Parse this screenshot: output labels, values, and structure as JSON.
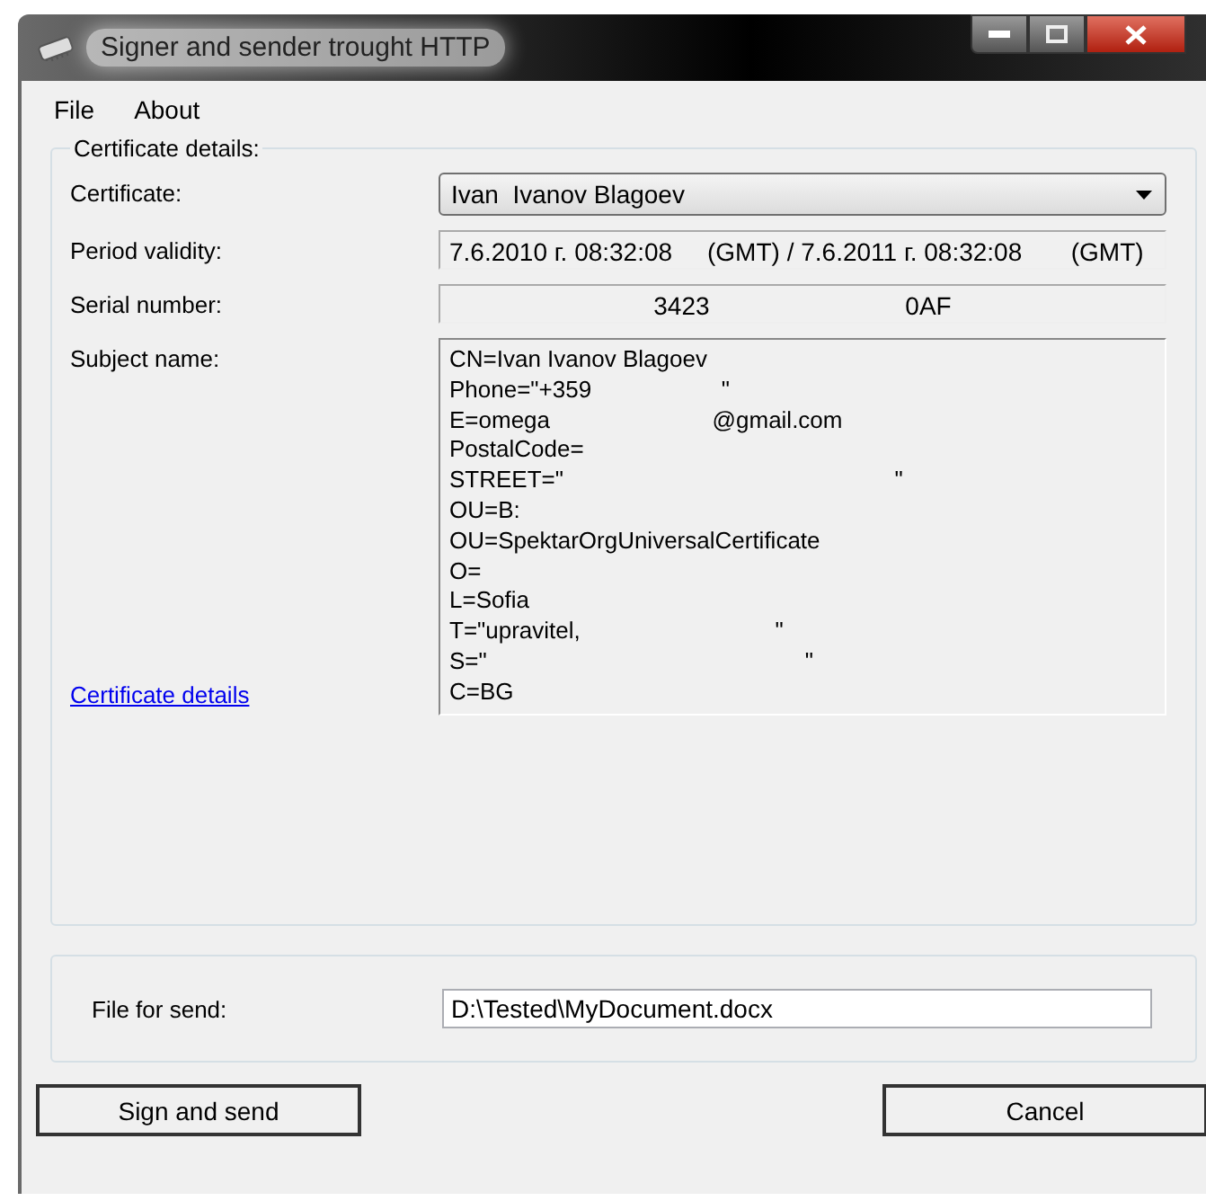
{
  "window": {
    "title": "Signer and sender trought HTTP"
  },
  "menu": [
    "File",
    "About"
  ],
  "certificate_group": {
    "title": "Certificate details:",
    "certificate": {
      "label": "Certificate:",
      "value": "Ivan  Ivanov Blagoev"
    },
    "period_validity": {
      "label": "Period validity:",
      "value": "7.6.2010 г. 08:32:08     (GMT) / 7.6.2011 г. 08:32:08       (GMT)"
    },
    "serial_number": {
      "label": "Serial number:",
      "value": "3423                            0AF"
    },
    "subject_name": {
      "label": "Subject name:",
      "lines": [
        "CN=Ivan Ivanov Blagoev",
        "Phone=\"+359                    \"",
        "E=omega                         @gmail.com",
        "PostalCode=",
        "STREET=\"                                                   \"",
        "OU=B:",
        "OU=SpektarOrgUniversalCertificate",
        "O=",
        "L=Sofia",
        "T=\"upravitel,                              \"",
        "S=\"                                                 \"",
        "C=BG"
      ]
    },
    "details_link": "Certificate details"
  },
  "file_group": {
    "label": "File for send:",
    "value": "D:\\Tested\\MyDocument.docx"
  },
  "buttons": [
    "Sign and send",
    "Cancel"
  ]
}
